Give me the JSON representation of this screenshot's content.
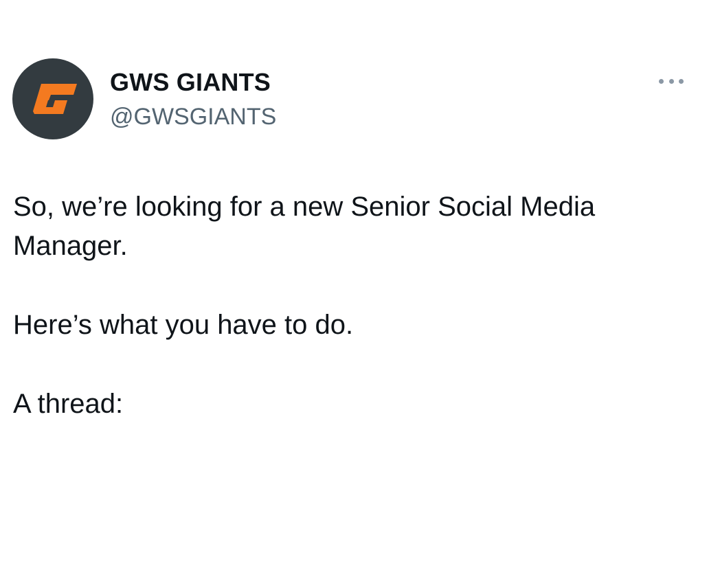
{
  "author": {
    "display_name": "GWS GIANTS",
    "handle": "@GWSGIANTS",
    "avatar_icon": "gws-giants-logo-icon",
    "avatar_bg": "#333b40",
    "logo_color": "#f47a20"
  },
  "menu": {
    "icon": "more-options-icon"
  },
  "tweet": {
    "paragraphs": [
      "So, we’re looking for a new Senior Social Media Manager.",
      "Here’s what you have to do.",
      "A thread:"
    ]
  }
}
